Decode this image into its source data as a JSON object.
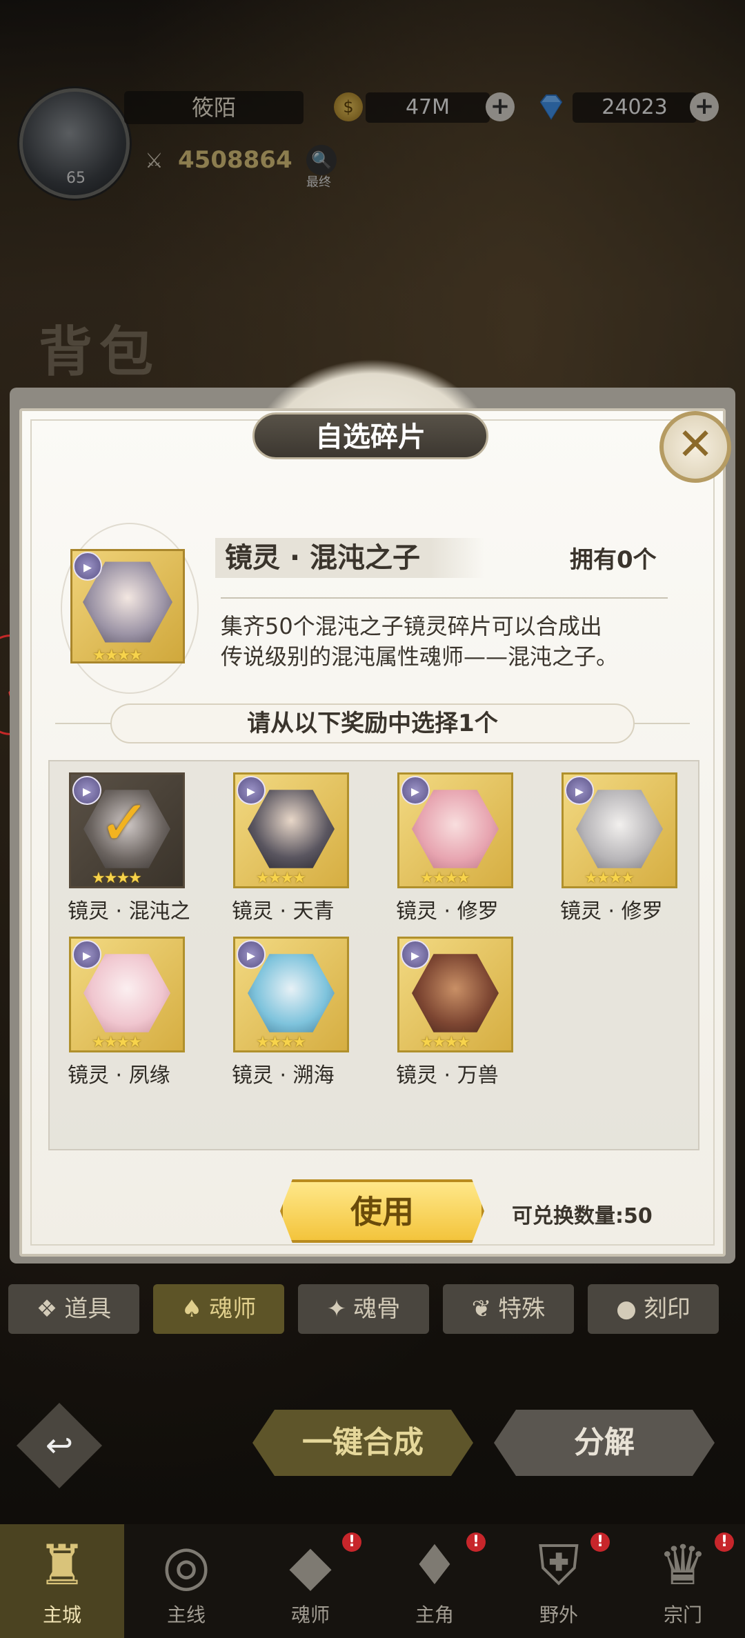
{
  "header": {
    "player_name": "筱陌",
    "level": "65",
    "gold": "47M",
    "diamonds": "24023",
    "power": "4508864",
    "search_label": "最终"
  },
  "background_label": "背包",
  "dialog": {
    "title": "自选碎片",
    "item_name": "镜灵 · 混沌之子",
    "owned": "拥有0个",
    "description_line1": "集齐50个混沌之子镜灵碎片可以合成出",
    "description_line2": "传说级别的混沌属性魂师——混沌之子。",
    "choose_prompt": "请从以下奖励中选择1个",
    "rewards": [
      {
        "name": "镜灵 · 混沌之",
        "stars": "★★★★",
        "selected": true
      },
      {
        "name": "镜灵 · 天青",
        "stars": "★★★★",
        "selected": false
      },
      {
        "name": "镜灵 · 修罗",
        "stars": "★★★★",
        "selected": false
      },
      {
        "name": "镜灵 · 修罗",
        "stars": "★★★★",
        "selected": false
      },
      {
        "name": "镜灵 · 夙缘",
        "stars": "★★★★",
        "selected": false
      },
      {
        "name": "镜灵 · 溯海",
        "stars": "★★★★",
        "selected": false
      },
      {
        "name": "镜灵 · 万兽",
        "stars": "★★★★",
        "selected": false
      }
    ],
    "use_button": "使用",
    "exchange_count": "可兑换数量:50"
  },
  "tabs": [
    "道具",
    "魂师",
    "魂骨",
    "特殊",
    "刻印"
  ],
  "actions": {
    "merge": "一键合成",
    "decompose": "分解"
  },
  "nav": [
    "主城",
    "主线",
    "魂师",
    "主角",
    "野外",
    "宗门"
  ],
  "colors": {
    "accent_gold": "#f3c43c",
    "dialog_bg": "#fbfaf6",
    "alert_red": "#c7262b"
  }
}
